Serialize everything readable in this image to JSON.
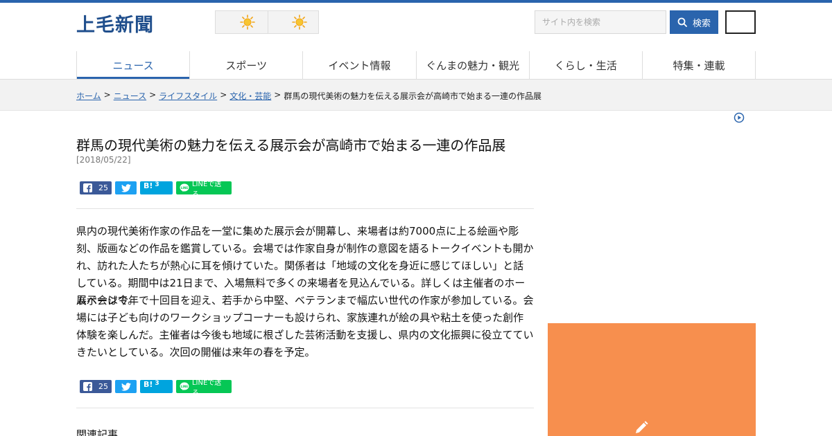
{
  "header": {
    "logo": "上毛新聞",
    "search_placeholder": "サイト内を検索",
    "search_button": "検索",
    "weather_left_icon": "sun-icon",
    "weather_right_icon": "sun-icon"
  },
  "nav": {
    "items": [
      {
        "label": "ニュース"
      },
      {
        "label": "スポーツ"
      },
      {
        "label": "イベント情報"
      },
      {
        "label": "ぐんまの魅力・観光"
      },
      {
        "label": "くらし・生活"
      },
      {
        "label": "特集・連載"
      }
    ]
  },
  "breadcrumb": {
    "items": [
      "ホーム",
      "ニュース",
      "ライフスタイル",
      "文化・芸能"
    ],
    "current": "群馬の現代美術の魅力を伝える展示会が高崎市で始まる一連の作品展"
  },
  "article": {
    "title": "群馬の現代美術の魅力を伝える展示会が高崎市で始まる一連の作品展",
    "date": "[2018/05/22]",
    "share": {
      "fb_count": "25",
      "hb_label": "B!",
      "hb_count": "3",
      "line_label": "LINEで送る"
    },
    "p1": "県内の現代美術作家の作品を一堂に集めた展示会が開幕し、来場者は約7000点に上る絵画や彫刻、版画などの作品を鑑賞している。会場では作家自身が制作の意図を語るトークイベントも開かれ、訪れた人たちが熱心に耳を傾けていた。関係者は「地域の文化を身近に感じてほしい」と話している。期間中は21日まで、入場無料で多くの来場者を見込んでいる。詳しくは主催者のホームページで。",
    "p2": "展示会は今年で十回目を迎え、若手から中堅、ベテランまで幅広い世代の作家が参加している。会場には子ども向けのワークショップコーナーも設けられ、家族連れが絵の具や粘土を使った創作体験を楽しんだ。主催者は今後も地域に根ざした芸術活動を支援し、県内の文化振興に役立てていきたいとしている。次回の開催は来年の春を予定。",
    "related_heading": "関連記事"
  },
  "colors": {
    "brand": "#2a64ad",
    "ad_box": "#f78f4e",
    "facebook": "#3b5998",
    "twitter": "#1da1f2",
    "hatena": "#00a4de",
    "line": "#06c755"
  }
}
